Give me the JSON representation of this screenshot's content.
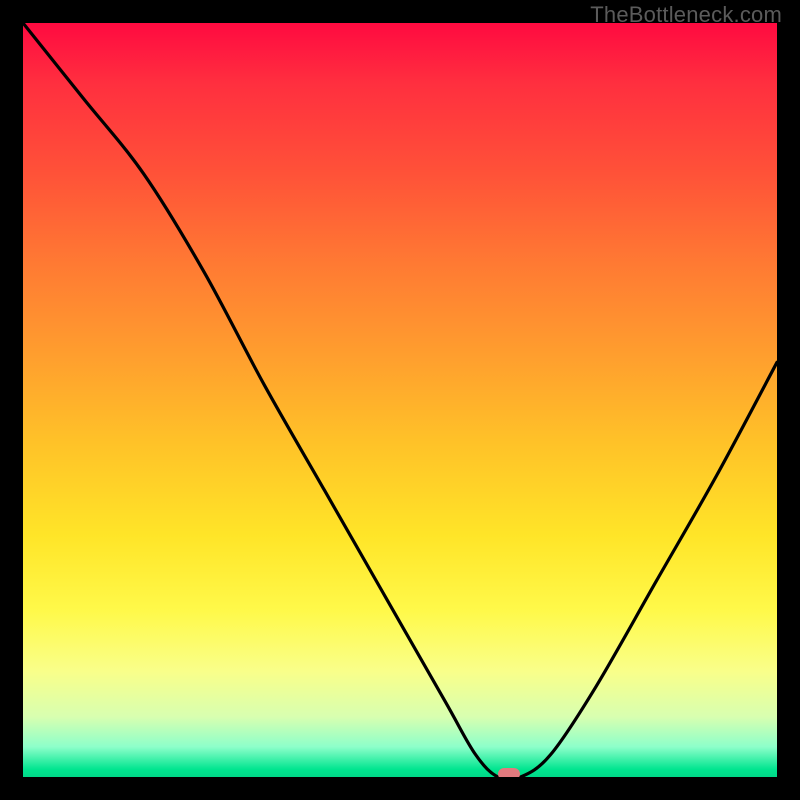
{
  "watermark": "TheBottleneck.com",
  "colors": {
    "frame": "#000000",
    "curve": "#000000",
    "marker": "#e17a7e",
    "gradient_top": "#ff0a40",
    "gradient_bottom": "#00d888"
  },
  "chart_data": {
    "type": "line",
    "title": "",
    "xlabel": "",
    "ylabel": "",
    "xlim": [
      0,
      100
    ],
    "ylim": [
      0,
      100
    ],
    "grid": false,
    "series": [
      {
        "name": "bottleneck-curve",
        "x": [
          0,
          8,
          16,
          24,
          32,
          40,
          48,
          56,
          60,
          63,
          66,
          70,
          76,
          84,
          92,
          100
        ],
        "values": [
          100,
          90,
          80,
          67,
          52,
          38,
          24,
          10,
          3,
          0,
          0,
          3,
          12,
          26,
          40,
          55
        ]
      }
    ],
    "annotations": [
      {
        "name": "optimal-marker",
        "x": 64.5,
        "y": 0
      }
    ]
  }
}
